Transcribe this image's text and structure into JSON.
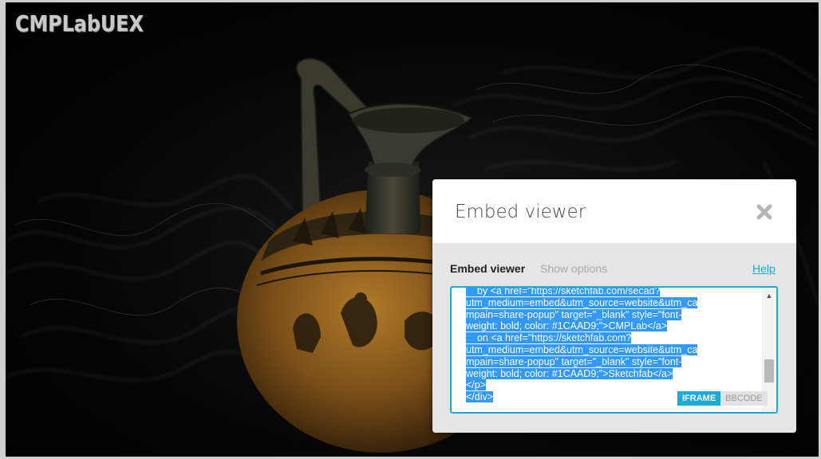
{
  "viewer": {
    "logo": "CMPLabUEX"
  },
  "modal": {
    "title": "Embed viewer",
    "close_icon": "close-icon",
    "section_label": "Embed viewer",
    "show_options": "Show options",
    "help": "Help",
    "code_lines": [
      "    by <a href=\"https://sketchfab.com/secad?",
      "utm_medium=embed&utm_source=website&utm_ca",
      "mpain=share-popup\" target=\"_blank\" style=\"font-",
      "weight: bold; color: #1CAAD9;\">CMPLab</a>",
      "    on <a href=\"https://sketchfab.com?",
      "utm_medium=embed&utm_source=website&utm_ca",
      "mpain=share-popup\" target=\"_blank\" style=\"font-",
      "weight: bold; color: #1CAAD9;\">Sketchfab</a>",
      "</p>",
      "</div>"
    ],
    "formats": {
      "iframe": "IFRAME",
      "bbcode": "BBCODE",
      "selected": "IFRAME"
    }
  },
  "colors": {
    "accent": "#1caad9",
    "selection": "#3399ff"
  }
}
